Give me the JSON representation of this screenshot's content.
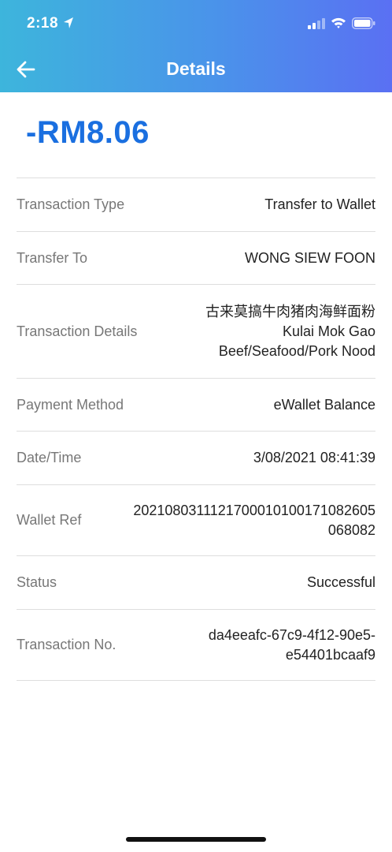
{
  "status_bar": {
    "time": "2:18"
  },
  "nav": {
    "title": "Details"
  },
  "amount": "-RM8.06",
  "rows": [
    {
      "label": "Transaction Type",
      "value": "Transfer to Wallet"
    },
    {
      "label": "Transfer To",
      "value": "WONG SIEW FOON"
    },
    {
      "label": "Transaction Details",
      "lines": [
        "古来莫搞牛肉猪肉海鲜面粉",
        "Kulai Mok Gao",
        "Beef/Seafood/Pork Nood"
      ]
    },
    {
      "label": "Payment Method",
      "value": "eWallet Balance"
    },
    {
      "label": "Date/Time",
      "value": "3/08/2021 08:41:39"
    },
    {
      "label": "Wallet Ref",
      "lines": [
        "20210803111217000101001710826​05",
        "068082"
      ]
    },
    {
      "label": "Status",
      "value": "Successful"
    },
    {
      "label": "Transaction No.",
      "lines": [
        "da4eeafc-67c9-4f12-90e5-",
        "e54401bcaaf9"
      ]
    }
  ],
  "colors": {
    "amount": "#1a6fe0",
    "header_start": "#3db5dc",
    "header_end": "#5a70f3"
  }
}
